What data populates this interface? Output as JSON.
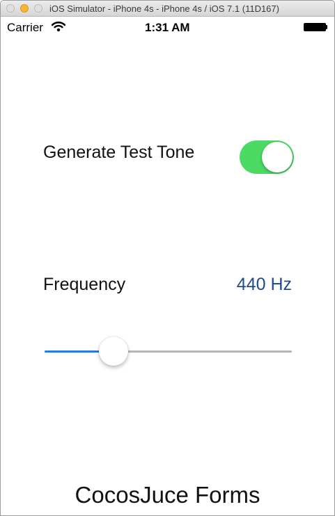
{
  "window": {
    "title": "iOS Simulator - iPhone 4s - iPhone 4s / iOS 7.1 (11D167)"
  },
  "statusbar": {
    "carrier": "Carrier",
    "wifi_icon": "wifi-icon",
    "time": "1:31 AM",
    "battery_icon": "battery-icon"
  },
  "tone": {
    "label": "Generate Test Tone",
    "switch_on": true,
    "switch_color": "#4cd964"
  },
  "frequency": {
    "label": "Frequency",
    "value_text": "440 Hz",
    "slider_fraction": 0.25,
    "value_color": "#1f4d8c",
    "slider_accent": "#147efb"
  },
  "footer": {
    "title": "CocosJuce Forms"
  }
}
